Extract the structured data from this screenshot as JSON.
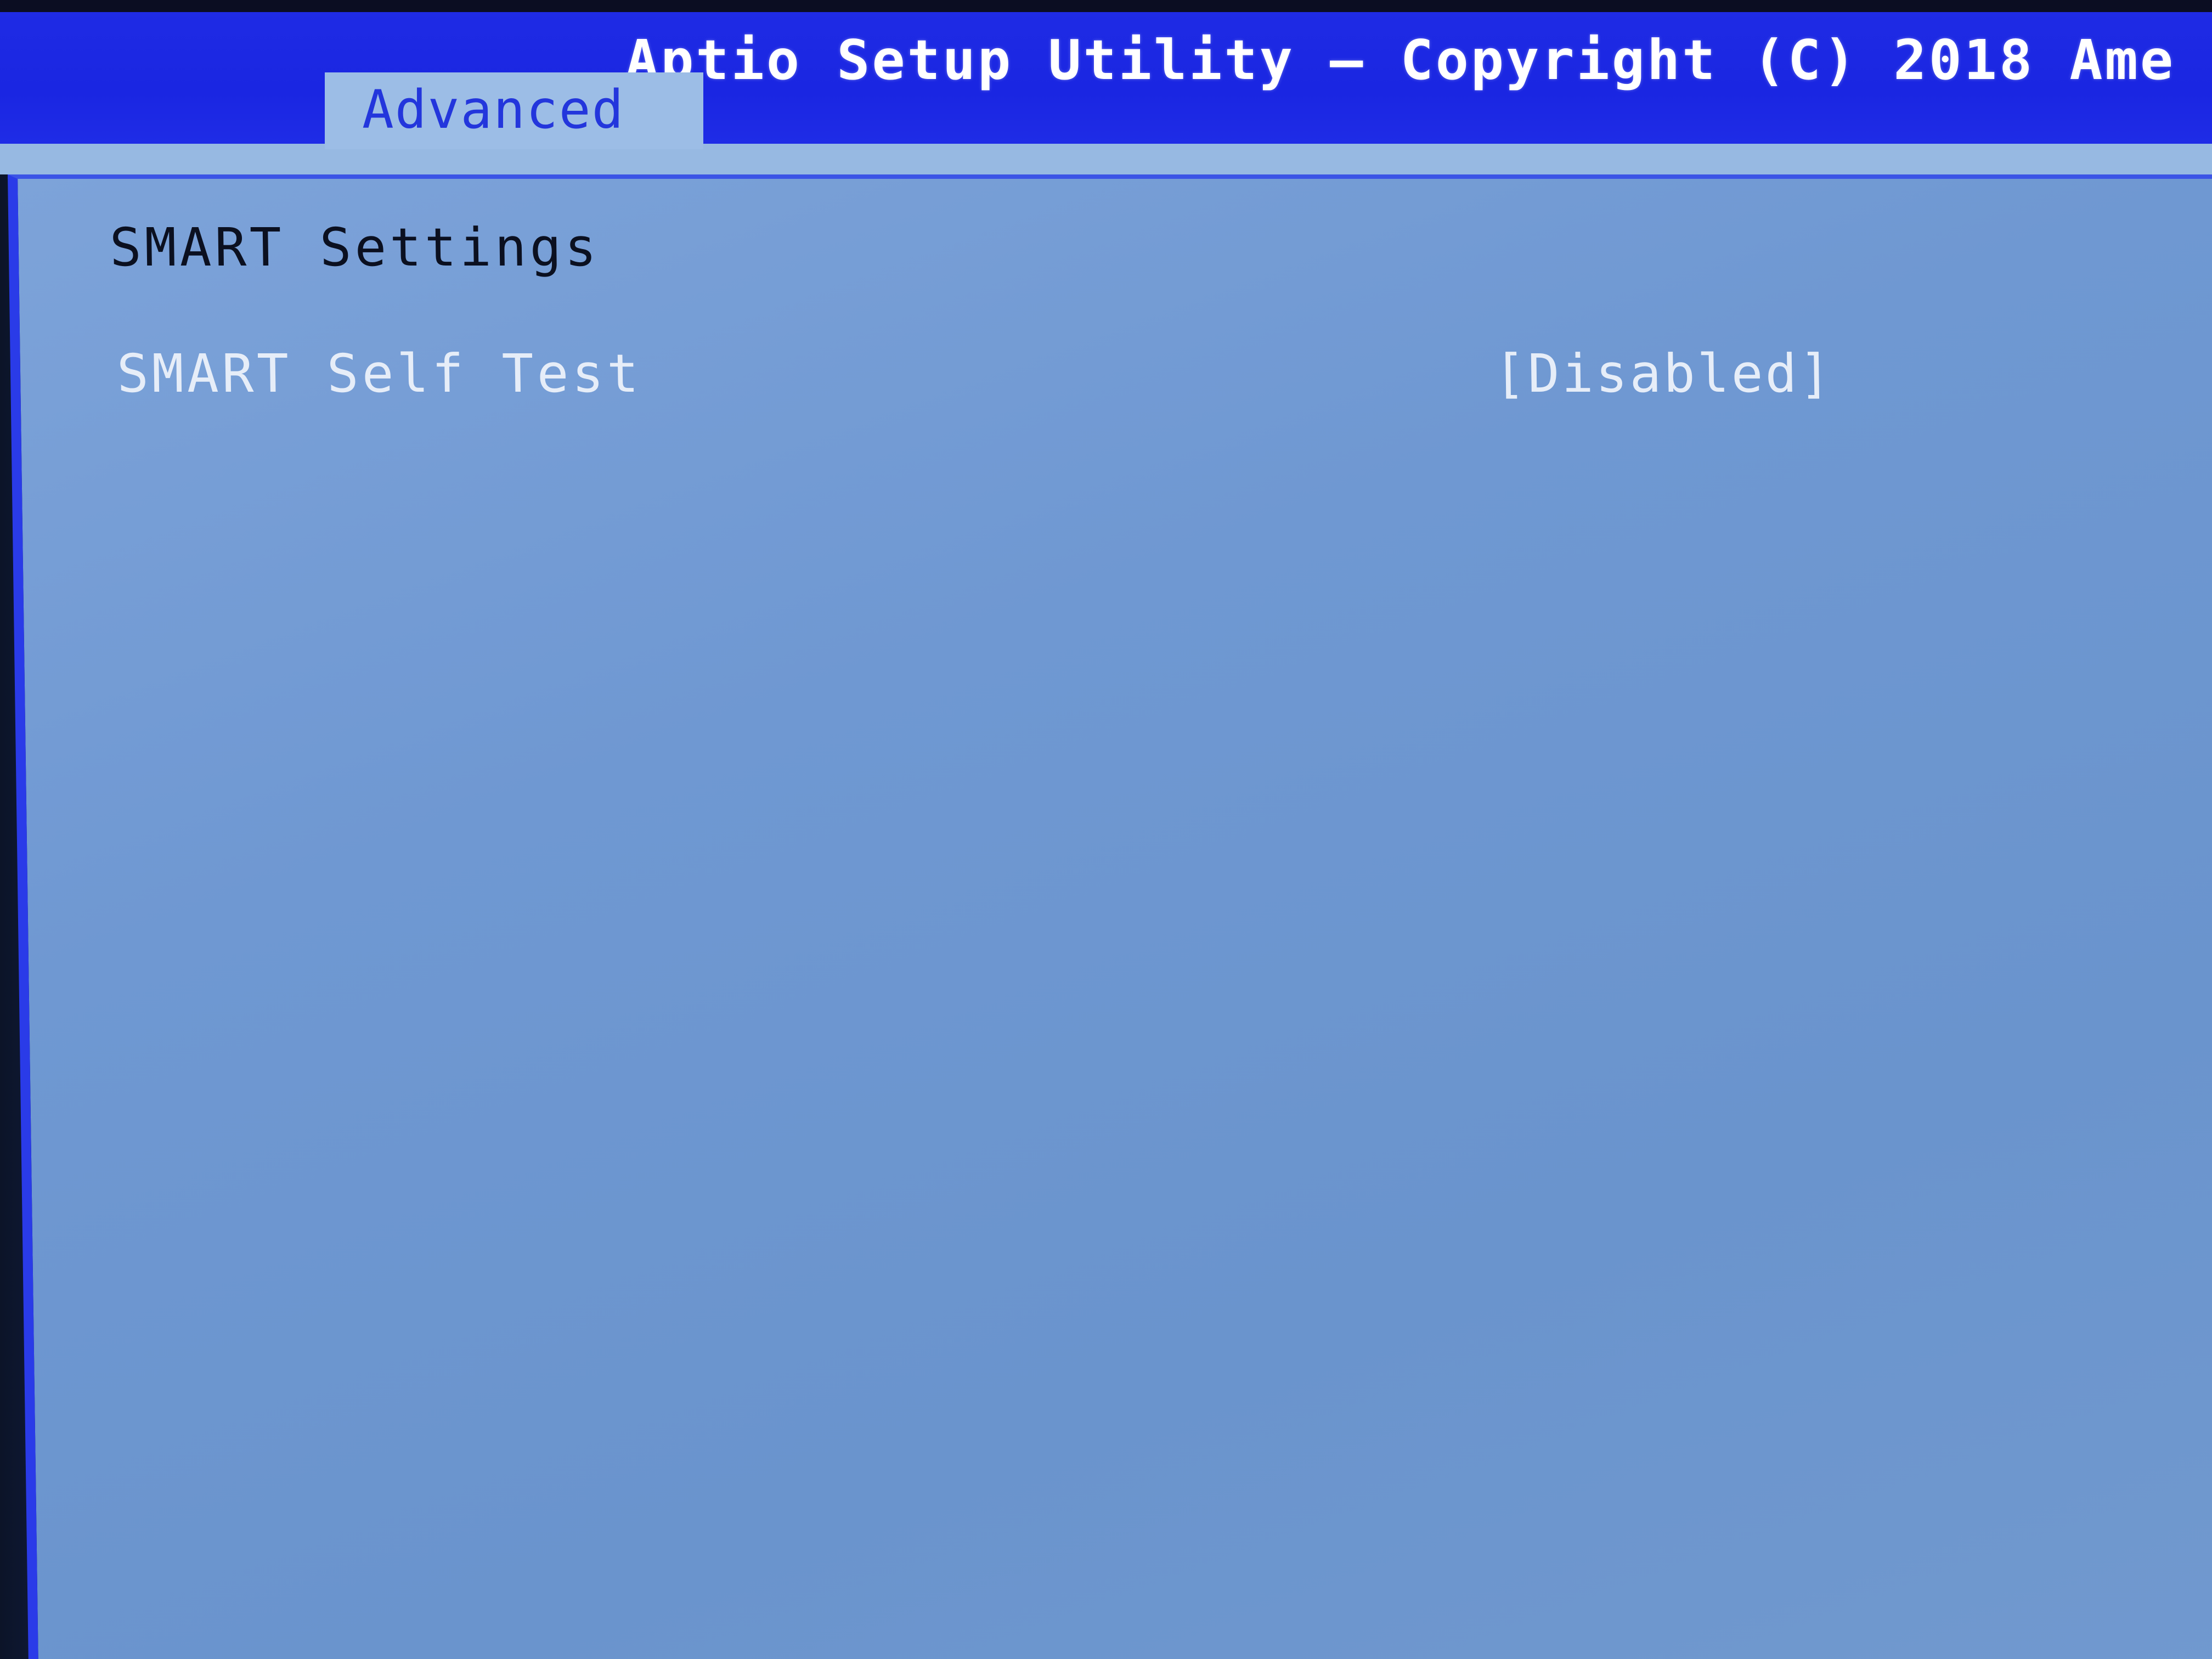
{
  "header": {
    "title": "Aptio Setup Utility – Copyright (C) 2018 Ame",
    "active_tab": "Advanced"
  },
  "main": {
    "section_title": "SMART Settings",
    "settings": [
      {
        "label": "SMART Self Test",
        "value": "[Disabled]"
      }
    ]
  },
  "colors": {
    "header_blue": "#1f2be4",
    "panel_blue": "#7199cf",
    "tab_bg": "#9cbde6",
    "tab_text": "#2336dc",
    "label_text": "#e6edf8",
    "title_text": "#0b1020"
  }
}
